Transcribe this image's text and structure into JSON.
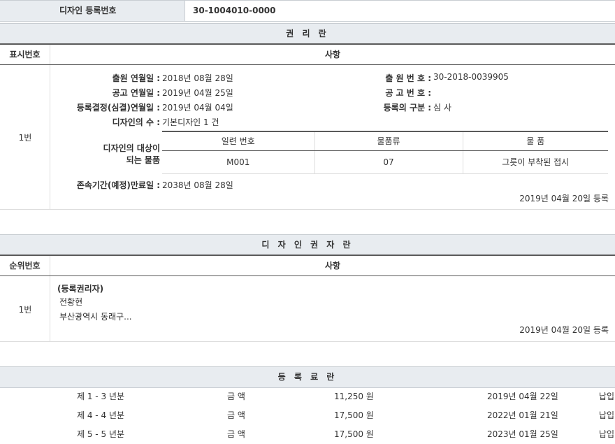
{
  "header": {
    "label": "디자인 등록번호",
    "value": "30-1004010-0000"
  },
  "rights_section": {
    "title": "권 리 란",
    "col_num": "표시번호",
    "col_content": "사항",
    "row_number": "1번",
    "filing_date_label": "출원 연월일 :",
    "filing_date": "2018년 08월 28일",
    "pub_date_label": "공고 연월일 :",
    "pub_date": "2019년 04월 25일",
    "decision_date_label": "등록결정(심결)연월일 :",
    "decision_date": "2019년 04월 04일",
    "design_count_label": "디자인의 수 :",
    "design_count": "기본디자인 1 건",
    "app_no_label": "출 원 번 호 :",
    "app_no": "30-2018-0039905",
    "pub_no_label": "공 고 번 호 :",
    "pub_no": "",
    "reg_type_label": "등록의 구분 :",
    "reg_type": "심 사",
    "target_label_1": "디자인의 대상이",
    "target_label_2": "되는 물품",
    "items_table": {
      "headers": [
        "일련 번호",
        "물품류",
        "물 품"
      ],
      "rows": [
        [
          "M001",
          "07",
          "그릇이 부착된 접시"
        ]
      ]
    },
    "expiry_label": "존속기간(예정)만료일 :",
    "expiry_date": "2038년 08월 28일",
    "reg_stamp": "2019년 04월 20일 등록"
  },
  "rights_holder_section": {
    "title": "디 자 인 권 자 란",
    "col_num": "순위번호",
    "col_content": "사항",
    "row_number": "1번",
    "holder_heading": "(등록권리자)",
    "holder_name": "전황현",
    "holder_address": "부산광역시 동래구...",
    "reg_stamp": "2019년 04월 20일 등록"
  },
  "fee_section": {
    "title": "등 록 료 란",
    "rows": [
      {
        "period": "제 1 - 3 년분",
        "amount_label": "금 액",
        "amount": "11,250 원",
        "date": "2019년 04월 22일",
        "status": "납입"
      },
      {
        "period": "제 4 - 4 년분",
        "amount_label": "금 액",
        "amount": "17,500 원",
        "date": "2022년 01월 21일",
        "status": "납입"
      },
      {
        "period": "제 5 - 5 년분",
        "amount_label": "금 액",
        "amount": "17,500 원",
        "date": "2023년 01월 25일",
        "status": "납입"
      }
    ]
  }
}
